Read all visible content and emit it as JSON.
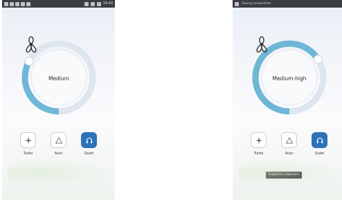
{
  "screens": [
    {
      "statusbar": {
        "time": "10:43",
        "notice": ""
      },
      "dial": {
        "level": 0.33,
        "label": "Medium"
      },
      "modes": [
        {
          "label": "Turbo",
          "icon": "turbo-fan-icon",
          "active": false
        },
        {
          "label": "Auto",
          "icon": "auto-triangle-icon",
          "active": false
        },
        {
          "label": "Quiet",
          "icon": "quiet-headphones-icon",
          "active": true
        }
      ],
      "toast": ""
    },
    {
      "statusbar": {
        "time": "",
        "notice": "Saving screenshot..."
      },
      "dial": {
        "level": 0.66,
        "label": "Medium-high"
      },
      "modes": [
        {
          "label": "Turbo",
          "icon": "turbo-fan-icon",
          "active": false
        },
        {
          "label": "Auto",
          "icon": "auto-triangle-icon",
          "active": false
        },
        {
          "label": "Quiet",
          "icon": "quiet-headphones-icon",
          "active": true
        }
      ],
      "toast": "Copied to clipboard"
    }
  ],
  "colors": {
    "accent": "#2d73b8",
    "arc": "#6eb7d6",
    "track": "#dde6ee"
  }
}
